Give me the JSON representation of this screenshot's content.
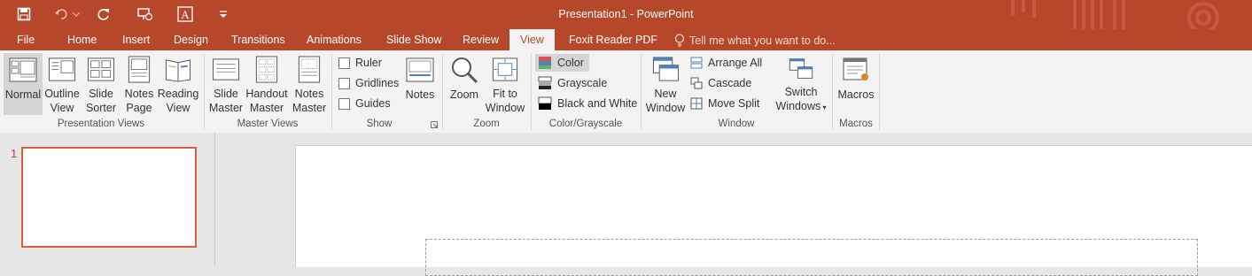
{
  "window": {
    "title": "Presentation1 - PowerPoint"
  },
  "qat": {
    "icons": [
      "save-icon",
      "undo-icon",
      "redo-icon",
      "present-from-beginning-icon",
      "font-icon",
      "customize-qat-icon"
    ]
  },
  "tabs": [
    {
      "label": "File"
    },
    {
      "label": "Home"
    },
    {
      "label": "Insert"
    },
    {
      "label": "Design"
    },
    {
      "label": "Transitions"
    },
    {
      "label": "Animations"
    },
    {
      "label": "Slide Show"
    },
    {
      "label": "Review"
    },
    {
      "label": "View",
      "active": true
    },
    {
      "label": "Foxit Reader PDF"
    }
  ],
  "tell_me": {
    "placeholder": "Tell me what you want to do..."
  },
  "ribbon": {
    "presentation_views": {
      "label": "Presentation Views",
      "normal": "Normal",
      "outline": [
        "Outline",
        "View"
      ],
      "sorter": [
        "Slide",
        "Sorter"
      ],
      "notes_page": [
        "Notes",
        "Page"
      ],
      "reading": [
        "Reading",
        "View"
      ]
    },
    "master_views": {
      "label": "Master Views",
      "slide_master": [
        "Slide",
        "Master"
      ],
      "handout_master": [
        "Handout",
        "Master"
      ],
      "notes_master": [
        "Notes",
        "Master"
      ]
    },
    "show": {
      "label": "Show",
      "ruler": "Ruler",
      "gridlines": "Gridlines",
      "guides": "Guides",
      "notes": "Notes"
    },
    "zoom": {
      "label": "Zoom",
      "zoom": "Zoom",
      "fit": [
        "Fit to",
        "Window"
      ]
    },
    "color": {
      "label": "Color/Grayscale",
      "color": "Color",
      "grayscale": "Grayscale",
      "bw": "Black and White"
    },
    "window": {
      "label": "Window",
      "new_window": [
        "New",
        "Window"
      ],
      "arrange_all": "Arrange All",
      "cascade": "Cascade",
      "move_split": "Move Split",
      "switch_windows": [
        "Switch",
        "Windows"
      ]
    },
    "macros": {
      "label": "Macros",
      "macros": "Macros"
    }
  },
  "thumbnails": {
    "slide_number": "1"
  },
  "colors": {
    "accent": "#b7472a",
    "ribbon_bg": "#f3f3f3",
    "selected": "#d5d5d5"
  }
}
